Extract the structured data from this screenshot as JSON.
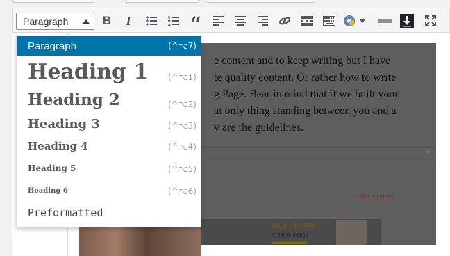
{
  "toolbar": {
    "format_value": "Paragraph",
    "buttons": [
      "bold-icon",
      "italic-icon",
      "bullet-list-icon",
      "numbered-list-icon",
      "blockquote-icon",
      "align-left-icon",
      "align-center-icon",
      "align-right-icon",
      "link-icon",
      "read-more-icon",
      "toolbar-toggle-icon",
      "plugin-icon",
      "horizontal-line-icon",
      "import-icon",
      "fullscreen-icon"
    ],
    "bold_glyph": "B",
    "italic_glyph": "I",
    "quote_glyph": "“"
  },
  "format_menu": {
    "items": [
      {
        "label": "Paragraph",
        "shortcut": "(^⌥7)",
        "selected": true
      },
      {
        "label": "Heading 1",
        "shortcut": "(^⌥1)"
      },
      {
        "label": "Heading 2",
        "shortcut": "(^⌥2)"
      },
      {
        "label": "Heading 3",
        "shortcut": "(^⌥3)"
      },
      {
        "label": "Heading 4",
        "shortcut": "(^⌥4)"
      },
      {
        "label": "Heading 5",
        "shortcut": "(^⌥5)"
      },
      {
        "label": "Heading 6",
        "shortcut": "(^⌥6)"
      },
      {
        "label": "Preformatted",
        "shortcut": ""
      }
    ]
  },
  "editor": {
    "text": "e content and to keep writing but I have\nte quality content.  Or rather how to write\ng Page.  Bear in mind that if we built your\nat only thing standing between you and a\nv are the guidelines.",
    "back_link": "‹ Back to Listings",
    "mls": "MLS #409506",
    "phone": "345-945-6060"
  },
  "colors": {
    "selected": "#0073aa",
    "toolbar_bg": "#f5f5f5",
    "overlay": "#5e5e5e"
  }
}
